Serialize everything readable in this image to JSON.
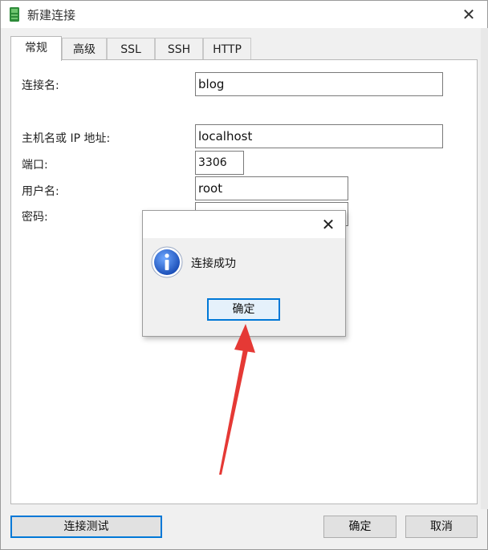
{
  "window": {
    "title": "新建连接",
    "close_glyph": "✕"
  },
  "tabs": [
    {
      "label": "常规",
      "active": true
    },
    {
      "label": "高级",
      "active": false
    },
    {
      "label": "SSL",
      "active": false
    },
    {
      "label": "SSH",
      "active": false
    },
    {
      "label": "HTTP",
      "active": false
    }
  ],
  "form": {
    "connection_name_label": "连接名:",
    "connection_name_value": "blog",
    "host_label": "主机名或 IP 地址:",
    "host_value": "localhost",
    "port_label": "端口:",
    "port_value": "3306",
    "user_label": "用户名:",
    "user_value": "root",
    "password_label": "密码:",
    "password_value": "•••••••••••••••"
  },
  "footer": {
    "test_button": "连接测试",
    "ok_button": "确定",
    "cancel_button": "取消"
  },
  "dialog": {
    "close_glyph": "✕",
    "message": "连接成功",
    "ok_button": "确定",
    "icon": "info-icon"
  },
  "colors": {
    "accent": "#0078d7",
    "arrow": "#e53935"
  }
}
